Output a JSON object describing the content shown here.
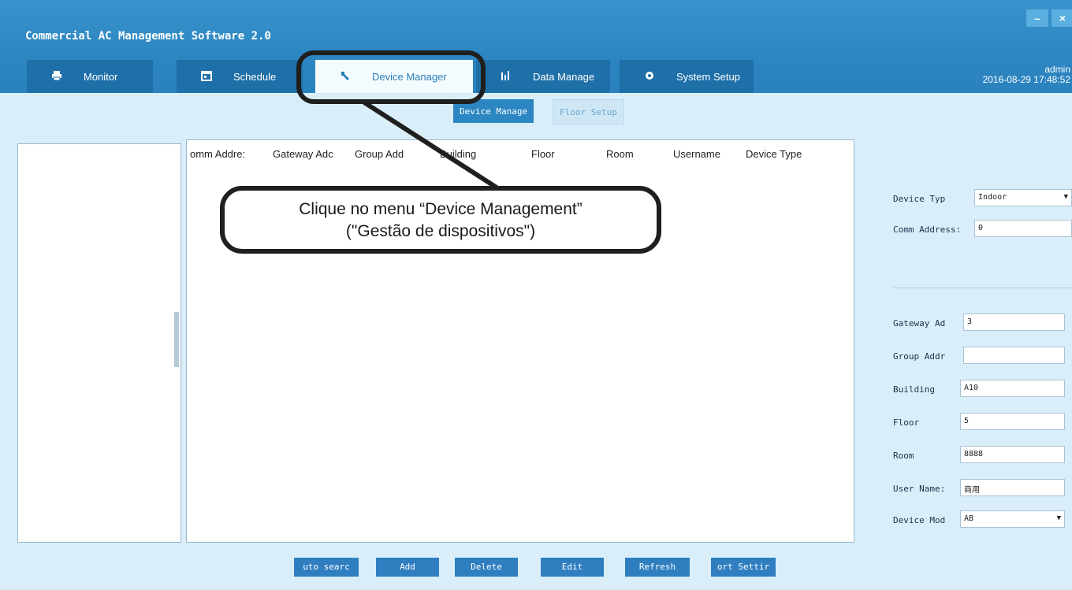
{
  "app": {
    "title": "Commercial AC Management Software 2.0",
    "window_controls": {
      "minimize": "–",
      "close": "×"
    }
  },
  "tabs": [
    {
      "label": "Monitor",
      "icon": "printer-icon",
      "active": false
    },
    {
      "label": "Schedule",
      "icon": "calendar-icon",
      "active": false
    },
    {
      "label": "Device Manager",
      "icon": "wrench-icon",
      "active": true
    },
    {
      "label": "Data Manage",
      "icon": "bar-chart-icon",
      "active": false
    },
    {
      "label": "System Setup",
      "icon": "gear-icon",
      "active": false
    }
  ],
  "user": {
    "name": "admin",
    "datetime": "2016-08-29 17:48:52"
  },
  "subtabs": [
    {
      "label": "Device Manage",
      "active": true
    },
    {
      "label": "Floor Setup",
      "active": false
    }
  ],
  "table": {
    "columns": [
      "omm Addre:",
      "Gateway Adc",
      "Group Add",
      "Building",
      "Floor",
      "Room",
      "Username",
      "Device Type"
    ],
    "rows": []
  },
  "form": {
    "device_type": {
      "label": "Device Typ",
      "value": "Indoor"
    },
    "comm_address": {
      "label": "Comm Address:",
      "value": "0"
    },
    "gateway_address": {
      "label": "Gateway Ad",
      "value": "3"
    },
    "group_address": {
      "label": "Group Addr",
      "value": ""
    },
    "building": {
      "label": "Building",
      "value": "A10"
    },
    "floor": {
      "label": "Floor",
      "value": "5"
    },
    "room": {
      "label": "Room",
      "value": "8888"
    },
    "user_name": {
      "label": "User Name:",
      "value": "商用"
    },
    "device_model": {
      "label": "Device Mod",
      "value": "AB"
    }
  },
  "buttons": {
    "auto_search": "uto searc",
    "add": "Add",
    "delete": "Delete",
    "edit": "Edit",
    "refresh": "Refresh",
    "port_settings": "ort Settir"
  },
  "annotation": {
    "line1": "Clique no menu “Device Management”",
    "line2": "(\"Gestão de dispositivos\")"
  },
  "colors": {
    "header": "#2c86c1",
    "tab_inactive": "#1f6fa8",
    "background": "#d9eef9",
    "button": "#2f7ec0"
  }
}
